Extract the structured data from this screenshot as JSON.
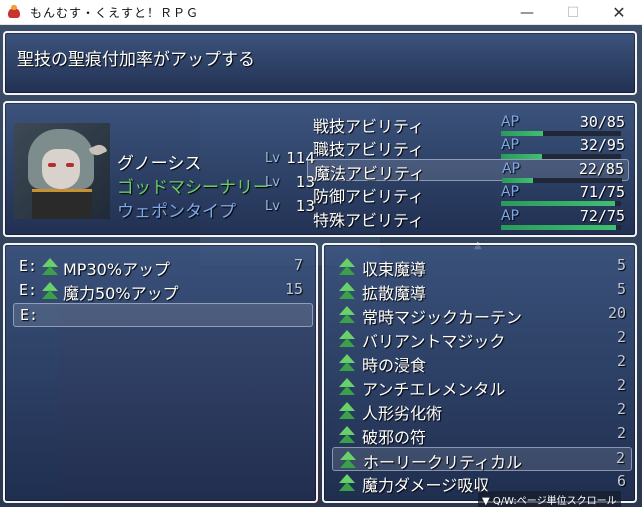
{
  "window": {
    "title": "もんむす・くえすと！ＲＰＧ",
    "min_glyph": "—",
    "max_glyph": "☐",
    "close_glyph": "✕"
  },
  "help": {
    "text": "聖技の聖痕付加率がアップする"
  },
  "status": {
    "rows": [
      {
        "label": "グノーシス",
        "lv_label": "Lv",
        "level": "114"
      },
      {
        "label": "ゴッドマシーナリー",
        "lv_label": "Lv",
        "level": "13"
      },
      {
        "label": "ウェポンタイプ",
        "lv_label": "Lv",
        "level": "13"
      }
    ]
  },
  "abilities": [
    {
      "name": "戦技アビリティ",
      "ap_label": "AP",
      "value": "30/85",
      "fill": 0.35
    },
    {
      "name": "職技アビリティ",
      "ap_label": "AP",
      "value": "32/95",
      "fill": 0.34
    },
    {
      "name": "魔法アビリティ",
      "ap_label": "AP",
      "value": "22/85",
      "fill": 0.26
    },
    {
      "name": "防御アビリティ",
      "ap_label": "AP",
      "value": "71/75",
      "fill": 0.95
    },
    {
      "name": "特殊アビリティ",
      "ap_label": "AP",
      "value": "72/75",
      "fill": 0.96
    }
  ],
  "equipped": [
    {
      "prefix": "E:",
      "name": "MP30%アップ",
      "cost": "7"
    },
    {
      "prefix": "E:",
      "name": "魔力50%アップ",
      "cost": "15"
    },
    {
      "prefix": "E:",
      "name": "",
      "cost": ""
    }
  ],
  "skills": [
    {
      "name": "収束魔導",
      "cost": "5"
    },
    {
      "name": "拡散魔導",
      "cost": "5"
    },
    {
      "name": "常時マジックカーテン",
      "cost": "20"
    },
    {
      "name": "バリアントマジック",
      "cost": "2"
    },
    {
      "name": "時の浸食",
      "cost": "2"
    },
    {
      "name": "アンチエレメンタル",
      "cost": "2"
    },
    {
      "name": "人形劣化術",
      "cost": "2"
    },
    {
      "name": "破邪の符",
      "cost": "2"
    },
    {
      "name": "ホーリークリティカル",
      "cost": "2"
    },
    {
      "name": "魔力ダメージ吸収",
      "cost": "6"
    }
  ],
  "hint": {
    "text": "▼ Q/W:ページ単位スクロール",
    "scroll_up": "▲"
  },
  "colors": {
    "accent_green": "#66d066",
    "label_blue": "#7fa8e8"
  }
}
